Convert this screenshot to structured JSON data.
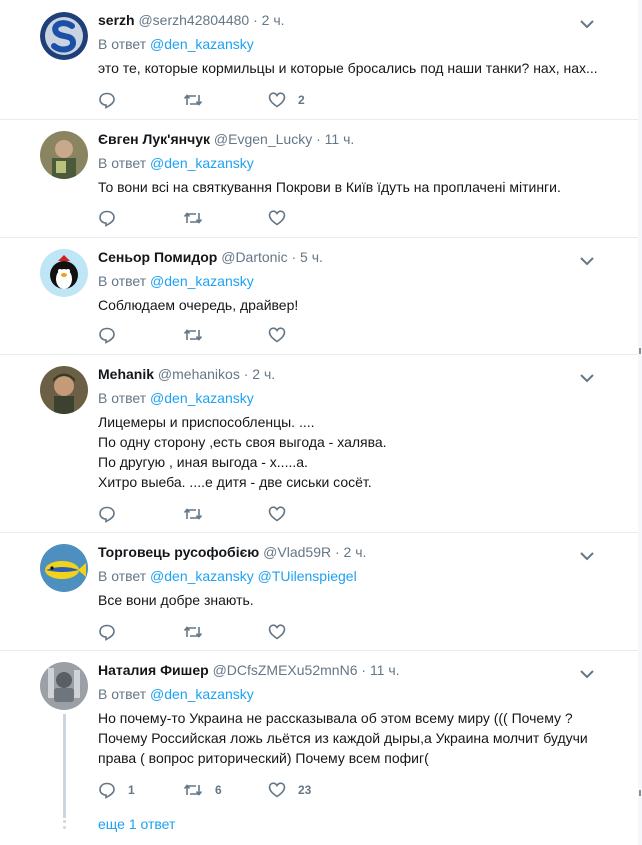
{
  "tweets": [
    {
      "name": "serzh",
      "handle": "@serzh42804480",
      "time": "2 ч.",
      "reply_prefix": "В ответ",
      "mentions": [
        "@den_kazansky"
      ],
      "lines": [
        "это те, которые кормильцы и которые бросались под наши танки? нах, нах..."
      ],
      "replies": "",
      "retweets": "",
      "likes": "2"
    },
    {
      "name": "Євген Лук'янчук",
      "handle": "@Evgen_Lucky",
      "time": "11 ч.",
      "reply_prefix": "В ответ",
      "mentions": [
        "@den_kazansky"
      ],
      "lines": [
        "То вони всі на святкування Покрови в Київ їдуть на проплачені мітинги."
      ],
      "replies": "",
      "retweets": "",
      "likes": ""
    },
    {
      "name": "Сеньор Помидор",
      "handle": "@Dartonic",
      "time": "5 ч.",
      "reply_prefix": "В ответ",
      "mentions": [
        "@den_kazansky"
      ],
      "lines": [
        "Соблюдаем очередь, драйвер!"
      ],
      "replies": "",
      "retweets": "",
      "likes": ""
    },
    {
      "name": "Mehanik",
      "handle": "@mehanikos",
      "time": "2 ч.",
      "reply_prefix": "В ответ",
      "mentions": [
        "@den_kazansky"
      ],
      "lines": [
        "Лицемеры и приспособленцы. ....",
        "По одну сторону  ,есть своя выгода - халява.",
        "По другую , иная выгода - х.....а.",
        "Хитро выеба. ....е дитя - две сиськи сосёт."
      ],
      "replies": "",
      "retweets": "",
      "likes": ""
    },
    {
      "name": "Торговець русофобією",
      "handle": "@Vlad59R",
      "time": "2 ч.",
      "reply_prefix": "В ответ",
      "mentions": [
        "@den_kazansky",
        "@TUilenspiegel"
      ],
      "lines": [
        "Все вони добре знають."
      ],
      "replies": "",
      "retweets": "",
      "likes": ""
    },
    {
      "name": "Наталия Фишер",
      "handle": "@DCfsZMEXu52mnN6",
      "time": "11 ч.",
      "reply_prefix": "В ответ",
      "mentions": [
        "@den_kazansky"
      ],
      "lines": [
        "Но почему-то Украина не рассказывала об этом всему миру ((( Почему ?",
        "Почему Российская ложь льётся из каждой дыры,а Украина молчит будучи",
        "права ( вопрос риторический) Почему всем пофиг("
      ],
      "replies": "1",
      "retweets": "6",
      "likes": "23"
    }
  ],
  "thread_more": "еще 1 ответ",
  "dot": "·",
  "colors": {
    "link": "#1da1f2",
    "muted": "#657786",
    "divider": "#e6ecf0",
    "thread": "#ccd6dd"
  }
}
